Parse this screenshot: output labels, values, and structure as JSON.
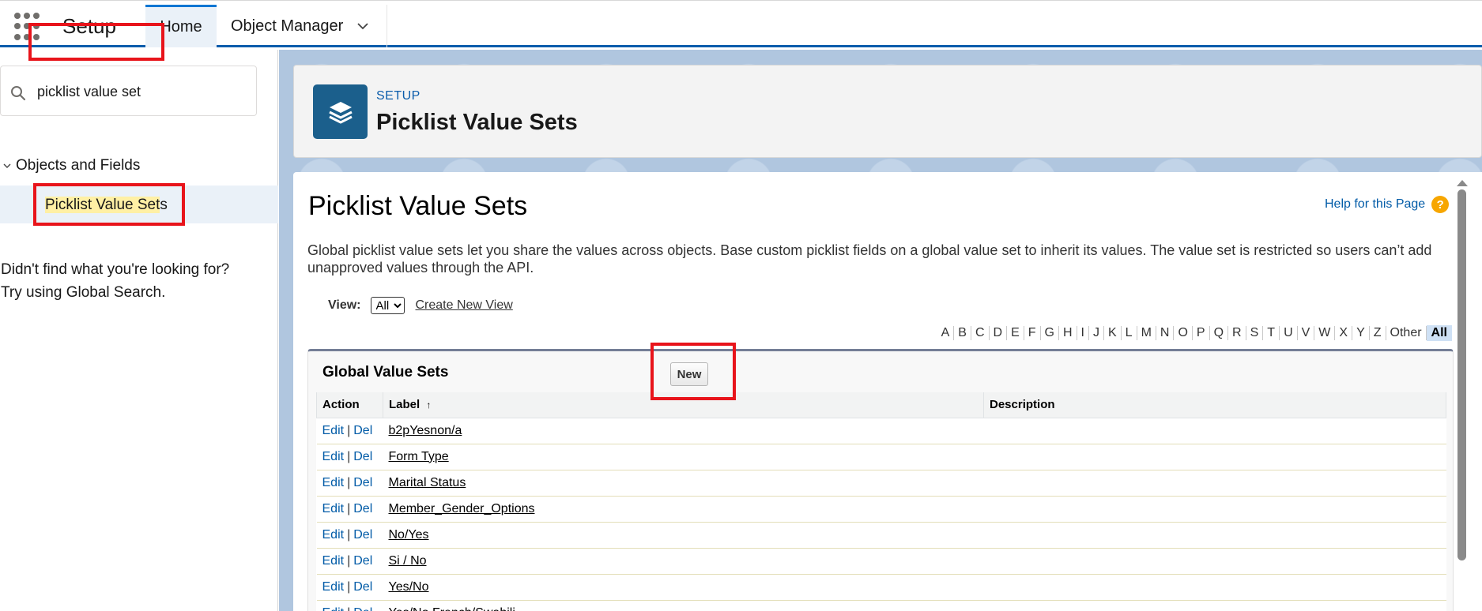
{
  "topbar": {
    "app_name": "Setup",
    "tabs": [
      {
        "label": "Home"
      },
      {
        "label": "Object Manager"
      }
    ]
  },
  "sidebar": {
    "search": {
      "value": "picklist value set"
    },
    "tree": {
      "parent_label": "Objects and Fields",
      "child_label_match": "Picklist Value Set",
      "child_label_rest": "s"
    },
    "not_found_line1": "Didn't find what you're looking for?",
    "not_found_line2": "Try using Global Search."
  },
  "header": {
    "eyebrow": "SETUP",
    "title": "Picklist Value Sets"
  },
  "content": {
    "page_title": "Picklist Value Sets",
    "help_link": "Help for this Page",
    "help_icon": "?",
    "description": "Global picklist value sets let you share the values across objects. Base custom picklist fields on a global value set to inherit its values. The value set is restricted so users can’t add unapproved values through the API.",
    "view_label": "View:",
    "view_selected": "All",
    "create_new_view": "Create New View",
    "alphabet": [
      "A",
      "B",
      "C",
      "D",
      "E",
      "F",
      "G",
      "H",
      "I",
      "J",
      "K",
      "L",
      "M",
      "N",
      "O",
      "P",
      "Q",
      "R",
      "S",
      "T",
      "U",
      "V",
      "W",
      "X",
      "Y",
      "Z",
      "Other",
      "All"
    ],
    "list_title": "Global Value Sets",
    "new_button": "New",
    "columns": {
      "action": "Action",
      "label": "Label",
      "sort_arrow": "↑",
      "description": "Description"
    },
    "edit_label": "Edit",
    "del_label": "Del",
    "action_sep": "|",
    "rows": [
      {
        "label": "b2pYesnon/a",
        "description": ""
      },
      {
        "label": "Form Type",
        "description": ""
      },
      {
        "label": "Marital Status",
        "description": ""
      },
      {
        "label": "Member_Gender_Options",
        "description": ""
      },
      {
        "label": "No/Yes",
        "description": ""
      },
      {
        "label": "Si / No",
        "description": ""
      },
      {
        "label": "Yes/No",
        "description": ""
      },
      {
        "label": "Yes/No French/Swahili",
        "description": ""
      }
    ]
  },
  "colors": {
    "brand_blue": "#0b5cab",
    "link_blue": "#015ba7",
    "highlight_red": "#e8141b",
    "header_icon": "#1b5f8c"
  },
  "icons": {
    "launcher": "app-launcher-icon",
    "search": "search-icon",
    "header": "layers-icon",
    "help": "help-icon"
  }
}
